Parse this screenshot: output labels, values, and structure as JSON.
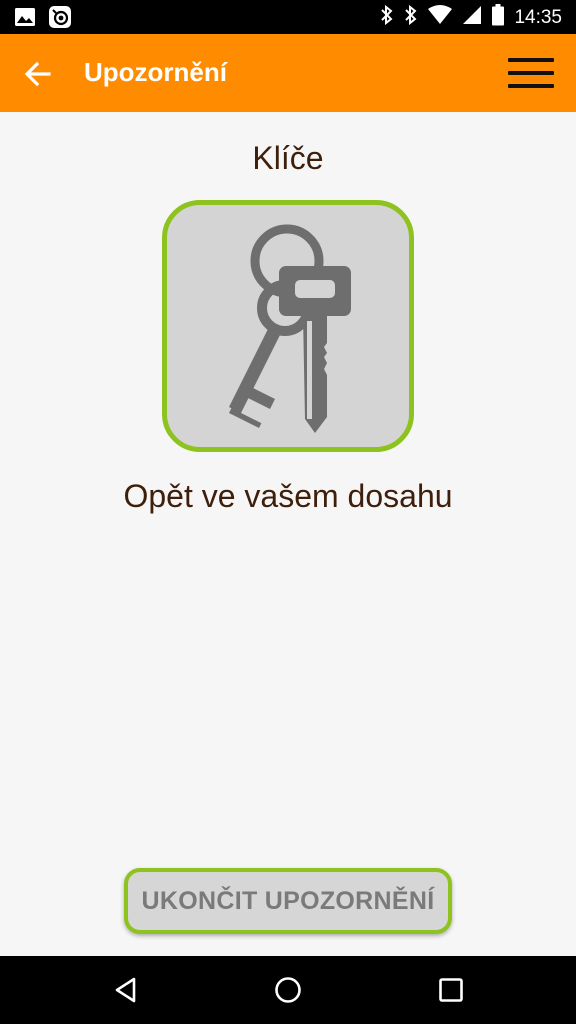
{
  "status_bar": {
    "time": "14:35",
    "left_icons": [
      "image-icon",
      "app-notification-icon"
    ],
    "right_icons": [
      "bluetooth-icon",
      "bluetooth-icon",
      "wifi-icon",
      "signal-icon",
      "battery-icon"
    ]
  },
  "app_bar": {
    "title": "Upozornění",
    "back_icon": "arrow-left-icon",
    "menu_icon": "hamburger-menu-icon",
    "background_color": "#ff8c00"
  },
  "alert": {
    "item_name": "Klíče",
    "item_icon": "keys-icon",
    "message": "Opět ve vašem dosahu",
    "tile_border_color": "#8dc21f"
  },
  "actions": {
    "end_alert_label": "UKONČIT UPOZORNĚNÍ"
  },
  "nav_bar": {
    "back_icon": "nav-back-icon",
    "home_icon": "nav-home-icon",
    "recents_icon": "nav-recents-icon"
  }
}
